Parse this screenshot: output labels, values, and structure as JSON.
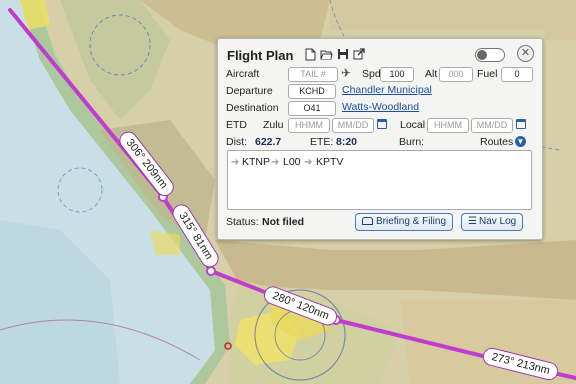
{
  "map": {
    "leg_labels": [
      "306° 209nm",
      "315° 81nm",
      "280° 120nm",
      "273° 213nm"
    ],
    "route_color": "#c03cd0"
  },
  "panel": {
    "title": "Flight Plan",
    "toolbar_icons": [
      "new-file-icon",
      "open-folder-icon",
      "save-icon",
      "share-icon"
    ],
    "aircraft_label": "Aircraft",
    "aircraft_placeholder": "TAIL #",
    "spd_label": "Spd",
    "spd_value": "100",
    "alt_label": "Alt",
    "alt_placeholder": "000",
    "fuel_label": "Fuel",
    "fuel_value": "0",
    "departure_label": "Departure",
    "departure_value": "KCHD",
    "departure_name": "Chandler Municipal",
    "destination_label": "Destination",
    "destination_value": "O41",
    "destination_name": "Watts-Woodland",
    "etd_label": "ETD",
    "zulu_label": "Zulu",
    "zulu_time_placeholder": "HHMM",
    "zulu_date_placeholder": "MM/DD",
    "local_label": "Local",
    "local_time_placeholder": "HHMM",
    "local_date_placeholder": "MM/DD",
    "dist_label": "Dist:",
    "dist_value": "622.7",
    "ete_label": "ETE:",
    "ete_value": "8:20",
    "burn_label": "Burn:",
    "routes_label": "Routes",
    "route_waypoints": [
      "KTNP",
      "L00",
      "KPTV"
    ],
    "status_label": "Status:",
    "status_value": "Not filed",
    "briefing_button": "Briefing & Filing",
    "navlog_button": "Nav Log"
  }
}
